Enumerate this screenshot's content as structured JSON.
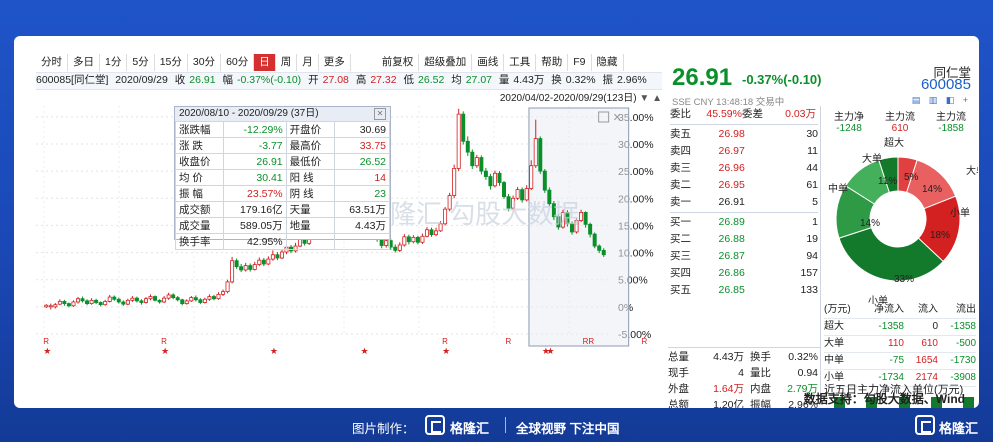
{
  "toolbar": {
    "left_items": [
      "分时",
      "多日",
      "1分",
      "5分",
      "15分",
      "30分",
      "60分",
      "日",
      "周",
      "月",
      "更多"
    ],
    "active_index": 7,
    "right_items": [
      "前复权",
      "超级叠加",
      "画线",
      "工具",
      "帮助",
      "F9",
      "隐藏"
    ]
  },
  "quote_line": {
    "code_name": "600085[同仁堂]",
    "date": "2020/09/29",
    "close_label": "收",
    "close_value": "26.91",
    "change_label": "幅",
    "change_value": "-0.37%(-0.10)",
    "open_label": "开",
    "open_value": "27.08",
    "high_label": "高",
    "high_value": "27.32",
    "low_label": "低",
    "low_value": "26.52",
    "avg_label": "均",
    "avg_value": "27.07",
    "vol_label": "量",
    "vol_value": "4.43万",
    "turnover_label": "换",
    "turnover_value": "0.32%",
    "amp_label": "振",
    "amp_value": "2.96%"
  },
  "range_text": "2020/04/02-2020/09/29(123日)",
  "stats_popup": {
    "header": "2020/08/10 - 2020/09/29 (37日)",
    "rows": [
      [
        "涨跌幅",
        "-12.29%",
        "开盘价",
        "30.69"
      ],
      [
        "涨 跌",
        "-3.77",
        "最高价",
        "33.75"
      ],
      [
        "收盘价",
        "26.91",
        "最低价",
        "26.52"
      ],
      [
        "均 价",
        "30.41",
        "阳 线",
        "14"
      ],
      [
        "振 幅",
        "23.57%",
        "阴 线",
        "23"
      ],
      [
        "成交额",
        "179.16亿",
        "天量",
        "63.51万"
      ],
      [
        "成交量",
        "589.05万",
        "地量",
        "4.43万"
      ],
      [
        "换手率",
        "42.95%",
        "",
        ""
      ]
    ]
  },
  "watermark": "格隆汇 勾股大数据",
  "chart_data": {
    "type": "candlestick",
    "y_axis": [
      "35.00%",
      "30.00%",
      "25.00%",
      "20.00%",
      "15.00%",
      "10.00%",
      "5.00%",
      "0%",
      "-5.00%"
    ],
    "ylim": [
      -5,
      37
    ],
    "candles": [
      [
        0,
        0.3,
        -0.2,
        0.5
      ],
      [
        0,
        0.2,
        -0.5,
        0.6
      ],
      [
        0,
        0.4,
        -0.3,
        0.7
      ],
      [
        0.5,
        1,
        0.3,
        1.4
      ],
      [
        1,
        0.6,
        0.2,
        1.3
      ],
      [
        0.6,
        0.2,
        -0.1,
        0.8
      ],
      [
        0.2,
        0.9,
        0,
        1.2
      ],
      [
        0.9,
        1.5,
        0.6,
        1.8
      ],
      [
        1.5,
        1.1,
        0.8,
        1.9
      ],
      [
        1.1,
        0.6,
        0.3,
        1.4
      ],
      [
        0.6,
        1.2,
        0.4,
        1.6
      ],
      [
        1.2,
        0.8,
        0.5,
        1.5
      ],
      [
        0.8,
        0.4,
        0.1,
        1
      ],
      [
        0.4,
        1,
        0.2,
        1.3
      ],
      [
        1,
        1.8,
        0.8,
        2.2
      ],
      [
        1.8,
        1.4,
        1.1,
        2.1
      ],
      [
        1.4,
        0.9,
        0.6,
        1.7
      ],
      [
        0.9,
        0.5,
        0.2,
        1.2
      ],
      [
        0.5,
        1.2,
        0.3,
        1.5
      ],
      [
        1.2,
        1.6,
        0.9,
        2
      ],
      [
        1.6,
        1.1,
        0.8,
        1.9
      ],
      [
        1.1,
        0.8,
        0.4,
        1.4
      ],
      [
        0.8,
        1.5,
        0.6,
        1.8
      ],
      [
        1.5,
        1.9,
        1.2,
        2.3
      ],
      [
        1.9,
        1.2,
        1,
        2.1
      ],
      [
        1.2,
        0.9,
        0.6,
        1.4
      ],
      [
        0.9,
        1.6,
        0.7,
        2
      ],
      [
        1.6,
        2.2,
        1.3,
        2.6
      ],
      [
        2.2,
        1.7,
        1.4,
        2.5
      ],
      [
        1.7,
        1.3,
        1,
        2
      ],
      [
        1.3,
        0.6,
        0.3,
        1.5
      ],
      [
        0.6,
        1.1,
        0.4,
        1.4
      ],
      [
        1.1,
        1.7,
        0.9,
        2
      ],
      [
        1.7,
        1.3,
        1,
        2.1
      ],
      [
        1.3,
        0.8,
        0.5,
        1.6
      ],
      [
        0.8,
        1.4,
        0.6,
        1.7
      ],
      [
        1.4,
        1.9,
        1.1,
        2.3
      ],
      [
        1.9,
        1.5,
        1.2,
        2.2
      ],
      [
        1.5,
        2.3,
        1.3,
        2.7
      ],
      [
        2.3,
        2.8,
        2,
        3.2
      ],
      [
        2.8,
        4.6,
        2.5,
        5
      ],
      [
        4.6,
        8.5,
        4.3,
        9.2
      ],
      [
        8.5,
        7.4,
        7,
        8.9
      ],
      [
        7.4,
        6.8,
        6.4,
        7.9
      ],
      [
        6.8,
        7.6,
        6.5,
        8.1
      ],
      [
        7.6,
        6.9,
        6.5,
        8
      ],
      [
        6.9,
        7.8,
        6.7,
        8.3
      ],
      [
        7.8,
        8.6,
        7.5,
        9.1
      ],
      [
        8.6,
        7.9,
        7.5,
        9
      ],
      [
        7.9,
        8.8,
        7.7,
        9.3
      ],
      [
        8.8,
        9.6,
        8.5,
        10.4
      ],
      [
        9.6,
        9,
        8.6,
        10.1
      ],
      [
        9,
        10.1,
        8.8,
        10.6
      ],
      [
        10.1,
        11,
        9.7,
        11.5
      ],
      [
        11,
        10.3,
        9.9,
        11.4
      ],
      [
        10.3,
        11.2,
        10,
        11.8
      ],
      [
        11.2,
        12.5,
        11,
        13
      ],
      [
        12.5,
        11.7,
        11.3,
        12.9
      ],
      [
        11.7,
        12.8,
        11.4,
        13.3
      ],
      [
        12.8,
        13.9,
        12.5,
        14.5
      ],
      [
        13.9,
        12.9,
        12.5,
        14.3
      ],
      [
        12.9,
        14.2,
        12.7,
        14.8
      ],
      [
        14.2,
        15.3,
        13.9,
        15.8
      ],
      [
        15.3,
        14.1,
        13.7,
        15.7
      ],
      [
        14.1,
        15,
        13.8,
        15.5
      ],
      [
        15,
        16.2,
        14.8,
        16.8
      ],
      [
        16.2,
        15.4,
        15,
        16.6
      ],
      [
        15.4,
        16.5,
        15.1,
        17
      ],
      [
        16.5,
        17.9,
        16.2,
        18.4
      ],
      [
        17.9,
        16.8,
        16.4,
        18.2
      ],
      [
        16.8,
        17.7,
        16.5,
        18.2
      ],
      [
        17.7,
        18.8,
        17.4,
        19.2
      ],
      [
        18.8,
        18,
        17.5,
        19.1
      ],
      [
        18,
        12.5,
        12,
        18.2
      ],
      [
        12.5,
        11.3,
        10.8,
        13
      ],
      [
        11.3,
        12.2,
        10.9,
        12.7
      ],
      [
        12.2,
        11,
        10.5,
        12.6
      ],
      [
        11,
        10.4,
        10,
        11.5
      ],
      [
        10.4,
        11.4,
        10.1,
        11.9
      ],
      [
        11.4,
        12.9,
        11.1,
        13.4
      ],
      [
        12.9,
        12,
        11.5,
        13.3
      ],
      [
        12,
        12.8,
        11.7,
        13.2
      ],
      [
        12.8,
        11.9,
        11.5,
        13.1
      ],
      [
        11.9,
        13,
        11.6,
        13.5
      ],
      [
        13,
        14.2,
        12.8,
        14.7
      ],
      [
        14.2,
        13.3,
        12.9,
        14.6
      ],
      [
        13.3,
        14,
        13,
        14.6
      ],
      [
        14,
        15.3,
        13.8,
        15.8
      ],
      [
        15.3,
        18,
        15,
        18.4
      ],
      [
        18,
        20.5,
        17.6,
        21
      ],
      [
        20.5,
        25.5,
        20,
        26.2
      ],
      [
        25.5,
        35.5,
        25,
        36.5
      ],
      [
        35.5,
        30.5,
        29.9,
        36
      ],
      [
        30.5,
        28.5,
        27.8,
        31.4
      ],
      [
        28.5,
        26,
        25.4,
        29
      ],
      [
        26,
        27.5,
        25.6,
        28
      ],
      [
        27.5,
        25,
        24.4,
        27.9
      ],
      [
        25,
        24,
        23.4,
        25.6
      ],
      [
        24,
        22.3,
        21.6,
        24.5
      ],
      [
        22.3,
        24.6,
        22,
        25.1
      ],
      [
        24.6,
        22.9,
        22.3,
        25
      ],
      [
        22.9,
        20.3,
        19.9,
        23.2
      ],
      [
        20.3,
        18.2,
        17.6,
        20.8
      ],
      [
        18.2,
        20,
        17.9,
        20.5
      ],
      [
        20,
        21.6,
        19.7,
        22.1
      ],
      [
        21.6,
        19.7,
        19.2,
        22
      ],
      [
        19.7,
        21.8,
        19.4,
        22.4
      ],
      [
        21.8,
        26,
        21.5,
        27
      ],
      [
        26,
        31,
        25.6,
        34.5
      ],
      [
        31,
        25,
        24.5,
        31.4
      ],
      [
        25,
        21.5,
        21,
        25.4
      ],
      [
        21.5,
        19,
        18.6,
        22
      ],
      [
        19,
        16.6,
        16,
        19.5
      ],
      [
        16.6,
        14.7,
        14.2,
        17
      ],
      [
        14.7,
        17.4,
        14.4,
        17.9
      ],
      [
        17.4,
        15.3,
        14.8,
        17.8
      ],
      [
        15.3,
        13.8,
        13.3,
        15.7
      ],
      [
        13.8,
        15.9,
        13.5,
        16.4
      ],
      [
        15.9,
        17.4,
        15.6,
        17.9
      ],
      [
        17.4,
        15.2,
        14.6,
        17.6
      ],
      [
        15.2,
        13.4,
        12.8,
        15.5
      ],
      [
        13.4,
        11.2,
        10.8,
        13.7
      ],
      [
        11.2,
        10.4,
        9.9,
        11.5
      ],
      [
        10.4,
        9.6,
        9.2,
        10.8
      ]
    ],
    "markers": [
      {
        "i": 0,
        "label": "R",
        "star": true
      },
      {
        "i": 26,
        "label": "R",
        "star": true
      },
      {
        "i": 50,
        "label": "",
        "star": true
      },
      {
        "i": 70,
        "label": "",
        "star": true
      },
      {
        "i": 88,
        "label": "R",
        "star": true
      },
      {
        "i": 102,
        "label": "R",
        "star": false
      },
      {
        "i": 110,
        "label": "",
        "star": true
      },
      {
        "i": 111,
        "label": "",
        "star": true
      },
      {
        "i": 119,
        "label": "RR",
        "star": false
      },
      {
        "i": 132,
        "label": "R",
        "star": false
      },
      {
        "i": 139,
        "label": "R",
        "star": false
      }
    ]
  },
  "quote_panel": {
    "price": "26.91",
    "change": "-0.37%(-0.10)",
    "name": "同仁堂",
    "code": "600085",
    "meta": "SSE  CNY  13:48:18  交易中",
    "icons": "▤ ▥ ◧ +"
  },
  "order_book": {
    "ratio": [
      "委比",
      "45.59%",
      "委差",
      "0.03万"
    ],
    "asks": [
      [
        "卖五",
        "26.98",
        "30"
      ],
      [
        "卖四",
        "26.97",
        "11"
      ],
      [
        "卖三",
        "26.96",
        "44"
      ],
      [
        "卖二",
        "26.95",
        "61"
      ],
      [
        "卖一",
        "26.91",
        "5"
      ]
    ],
    "bids": [
      [
        "买一",
        "26.89",
        "1"
      ],
      [
        "买二",
        "26.88",
        "19"
      ],
      [
        "买三",
        "26.87",
        "94"
      ],
      [
        "买四",
        "26.86",
        "157"
      ],
      [
        "买五",
        "26.85",
        "133"
      ]
    ]
  },
  "summary": [
    [
      "总量",
      "4.43万",
      "换手",
      "0.32%"
    ],
    [
      "现手",
      "4",
      "量比",
      "0.94"
    ],
    [
      "外盘",
      "1.64万",
      "内盘",
      "2.79万"
    ],
    [
      "总额",
      "1.20亿",
      "振幅",
      "2.96%"
    ],
    [
      "均价",
      "27.07",
      "开盘",
      "27.08"
    ]
  ],
  "flow_header": {
    "labels": [
      "主力净",
      "主力流",
      "主力流"
    ],
    "values": [
      "-1248",
      "610",
      "-1858"
    ]
  },
  "donut": {
    "labels": [
      "超大",
      "大单",
      "中单",
      "小单",
      "大单",
      "中单",
      "小单"
    ],
    "segments": [
      {
        "name": "超大流入",
        "value": 0,
        "color": "#d32020"
      },
      {
        "name": "大单流入",
        "value": 5,
        "color": "#e04040"
      },
      {
        "name": "中单流入",
        "value": 14,
        "color": "#e86060"
      },
      {
        "name": "小单流入",
        "value": 18,
        "color": "#d32020"
      },
      {
        "name": "小单流出",
        "value": 33,
        "color": "#137a2c"
      },
      {
        "name": "中单流出",
        "value": 14,
        "color": "#2f9a45"
      },
      {
        "name": "大单流出",
        "value": 11,
        "color": "#45b05b"
      },
      {
        "name": "超大流出",
        "value": 5,
        "color": "#137a2c"
      }
    ],
    "pct_labels": [
      "5%",
      "14%",
      "18%",
      "33%",
      "14%",
      "11%"
    ]
  },
  "flow_table": {
    "header": [
      "(万元)",
      "净流入",
      "流入",
      "流出"
    ],
    "rows": [
      [
        "超大",
        "-1358",
        "0",
        "-1358"
      ],
      [
        "大单",
        "110",
        "610",
        "-500"
      ],
      [
        "中单",
        "-75",
        "1654",
        "-1730"
      ],
      [
        "小单",
        "-1734",
        "2174",
        "-3908"
      ]
    ]
  },
  "flow_title": "近五日主力净流入单位(万元)",
  "source": "数据支持：勾股大数据、Wind",
  "footer": {
    "made_by": "图片制作：",
    "brand": "格隆汇",
    "slogan": "全球视野 下注中国",
    "brand_right": "格隆汇"
  }
}
